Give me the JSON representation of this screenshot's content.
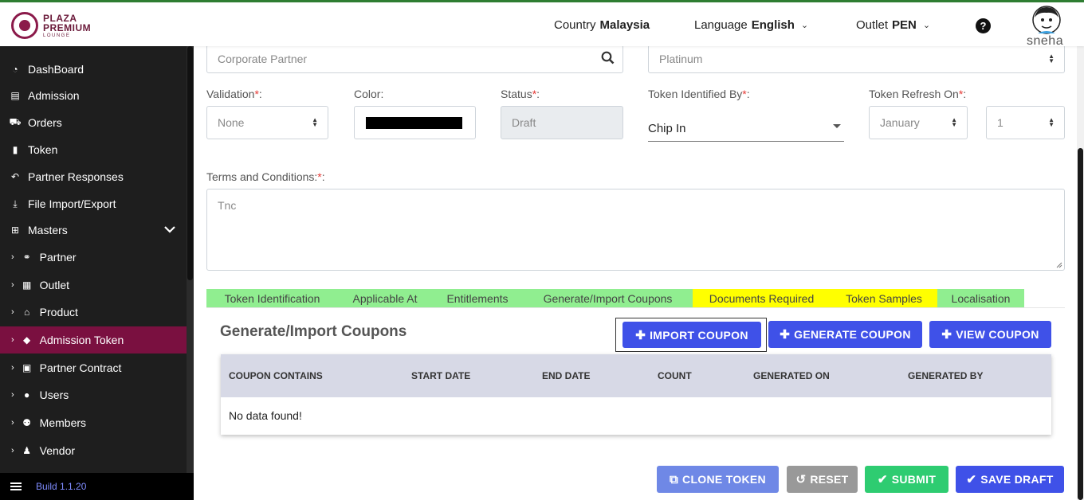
{
  "header": {
    "logo": {
      "line1": "PLAZA",
      "line2": "PREMIUM",
      "line3": "LOUNGE"
    },
    "country_label": "Country",
    "country_value": "Malaysia",
    "language_label": "Language",
    "language_value": "English",
    "outlet_label": "Outlet",
    "outlet_value": "PEN",
    "help_glyph": "?",
    "username": "sneha"
  },
  "sidebar": {
    "items": [
      {
        "label": "DashBoard",
        "icon": "dashboard-icon",
        "glyph": "◔"
      },
      {
        "label": "Admission",
        "icon": "id-card-icon",
        "glyph": "▤"
      },
      {
        "label": "Orders",
        "icon": "cart-icon",
        "glyph": "⛟"
      },
      {
        "label": "Token",
        "icon": "file-icon",
        "glyph": "▮"
      },
      {
        "label": "Partner Responses",
        "icon": "reply-all-icon",
        "glyph": "↶"
      },
      {
        "label": "File Import/Export",
        "icon": "download-icon",
        "glyph": "⤓"
      },
      {
        "label": "Masters",
        "icon": "sitemap-icon",
        "glyph": "⊞"
      }
    ],
    "sub_items": [
      {
        "label": "Partner",
        "icon": "handshake-icon",
        "glyph": "⚭"
      },
      {
        "label": "Outlet",
        "icon": "building-icon",
        "glyph": "▦"
      },
      {
        "label": "Product",
        "icon": "gift-icon",
        "glyph": "⌂"
      },
      {
        "label": "Admission Token",
        "icon": "tag-icon",
        "glyph": "◆"
      },
      {
        "label": "Partner Contract",
        "icon": "briefcase-icon",
        "glyph": "▣"
      },
      {
        "label": "Users",
        "icon": "user-icon",
        "glyph": "●"
      },
      {
        "label": "Members",
        "icon": "users-icon",
        "glyph": "⚉"
      },
      {
        "label": "Vendor",
        "icon": "person-icon",
        "glyph": "♟"
      }
    ],
    "active": "Admission Token",
    "build": "Build 1.1.20"
  },
  "form": {
    "corporate_partner_placeholder": "Corporate Partner",
    "tier_value": "Platinum",
    "validation_label": "Validation",
    "validation_value": "None",
    "color_label": "Color:",
    "status_label": "Status",
    "status_value": "Draft",
    "token_identified_label": "Token Identified By",
    "token_identified_value": "Chip In",
    "token_refresh_label": "Token Refresh On",
    "refresh_month": "January",
    "refresh_day": "1",
    "terms_label": "Terms and Conditions:",
    "terms_placeholder": "Tnc",
    "required_mark": "*",
    "colon": ":",
    "swatch_color": "#000000"
  },
  "tabs": [
    {
      "label": "Token Identification",
      "color": "green"
    },
    {
      "label": "Applicable At",
      "color": "green"
    },
    {
      "label": "Entitlements",
      "color": "green"
    },
    {
      "label": "Generate/Import Coupons",
      "color": "green"
    },
    {
      "label": "Documents Required",
      "color": "yellow"
    },
    {
      "label": "Token Samples",
      "color": "yellow"
    },
    {
      "label": "Localisation",
      "color": "green"
    }
  ],
  "coupons": {
    "title": "Generate/Import Coupons",
    "import_label": "IMPORT COUPON",
    "generate_label": "GENERATE COUPON",
    "view_label": "VIEW COUPON",
    "columns": [
      "COUPON CONTAINS",
      "START DATE",
      "END DATE",
      "COUNT",
      "GENERATED ON",
      "GENERATED BY"
    ],
    "empty_text": "No data found!"
  },
  "footer_buttons": {
    "clone": "CLONE TOKEN",
    "reset": "RESET",
    "submit": "SUBMIT",
    "save_draft": "SAVE DRAFT"
  },
  "colors": {
    "sidebar_active": "#7a1040",
    "primary_button": "#3f51e8",
    "tab_green": "#90ee90",
    "tab_yellow": "#ffff00"
  }
}
